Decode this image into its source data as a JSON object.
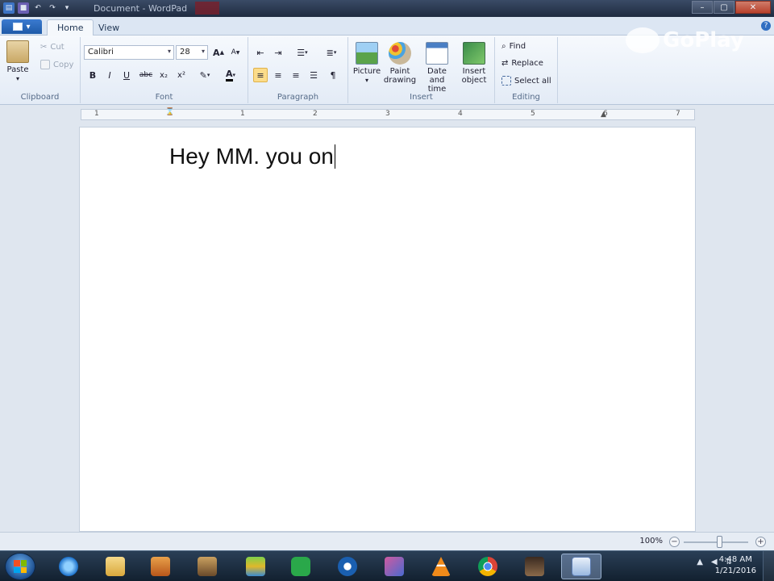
{
  "window": {
    "title": "Document - WordPad"
  },
  "tabs": {
    "home": "Home",
    "view": "View"
  },
  "clipboard": {
    "paste": "Paste",
    "cut": "Cut",
    "copy": "Copy",
    "label": "Clipboard"
  },
  "font": {
    "family": "Calibri",
    "size": "28",
    "label": "Font",
    "bold": "B",
    "italic": "I",
    "underline": "U",
    "strike": "abc",
    "subscript": "x₂",
    "superscript": "x²",
    "grow": "A",
    "shrink": "A"
  },
  "paragraph": {
    "label": "Paragraph"
  },
  "insert": {
    "picture": "Picture",
    "paint": "Paint drawing",
    "datetime": "Date and time",
    "object": "Insert object",
    "label": "Insert"
  },
  "editing": {
    "find": "Find",
    "replace": "Replace",
    "select_all": "Select all",
    "label": "Editing"
  },
  "ruler": {
    "marks": [
      "1",
      "1",
      "2",
      "3",
      "4",
      "5",
      "6",
      "7"
    ]
  },
  "document": {
    "text": "Hey MM. you on"
  },
  "status": {
    "zoom": "100%"
  },
  "taskbar": {
    "time": "4:48 AM",
    "date": "1/21/2016"
  },
  "watermark": {
    "text": "GoPlay"
  }
}
